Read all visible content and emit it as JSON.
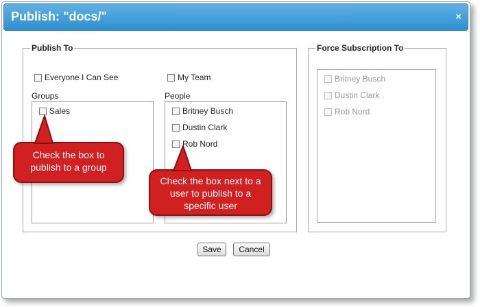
{
  "dialog": {
    "title": "Publish: \"docs/\"",
    "close_glyph": "×"
  },
  "publish_to": {
    "legend": "Publish To",
    "everyone_label": "Everyone I Can See",
    "my_team_label": "My Team",
    "groups_label": "Groups",
    "people_label": "People",
    "groups": [
      "Sales"
    ],
    "people": [
      "Britney Busch",
      "Dustin Clark",
      "Rob Nord"
    ]
  },
  "force_subscription": {
    "legend": "Force Subscription To",
    "people": [
      "Britney Busch",
      "Dustin Clark",
      "Rob Nord"
    ]
  },
  "callouts": {
    "group": "Check the  box to publish to a group",
    "user": "Check the box next to a user to publish to a specific user"
  },
  "buttons": {
    "save": "Save",
    "cancel": "Cancel"
  },
  "colors": {
    "title_bar": "#3d98d6",
    "callout": "#d21f1f"
  }
}
